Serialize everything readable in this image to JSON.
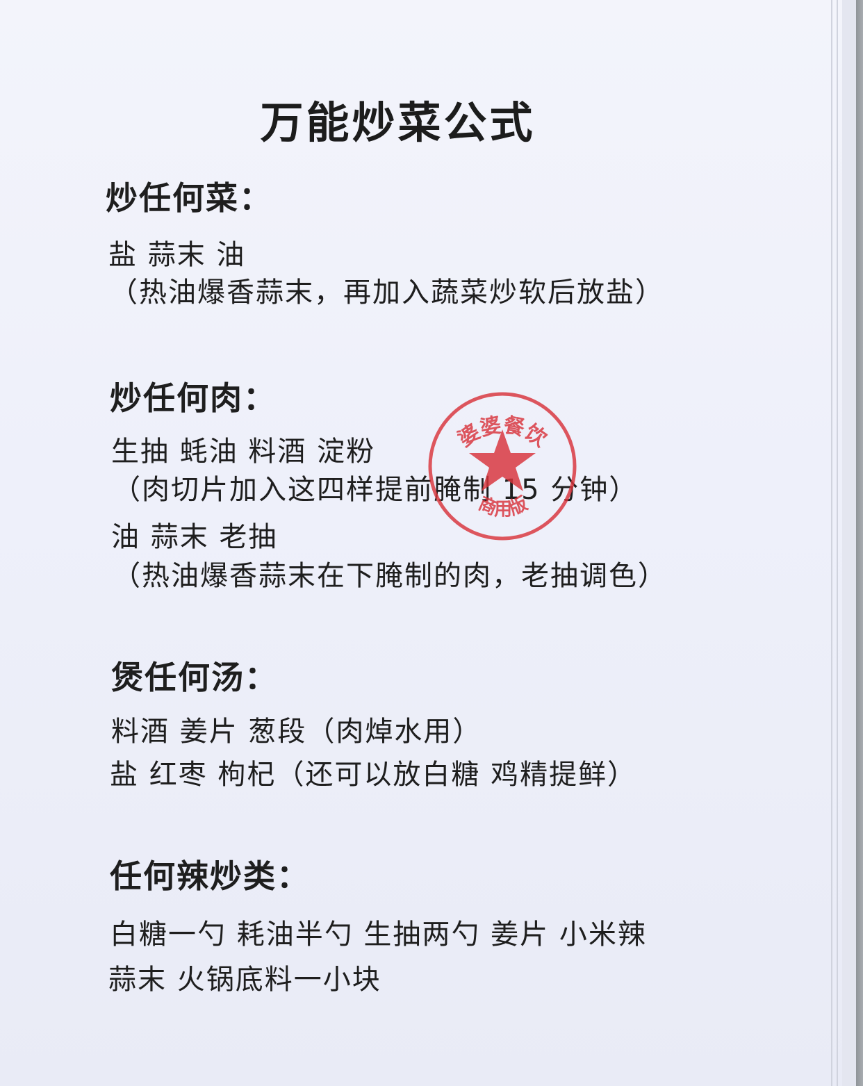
{
  "title": "万能炒菜公式",
  "sections": [
    {
      "heading": "炒任何菜：",
      "lines": [
        "盐 蒜末 油",
        "（热油爆香蒜末，再加入蔬菜炒软后放盐）"
      ]
    },
    {
      "heading": "炒任何肉：",
      "lines": [
        "生抽 蚝油 料酒 淀粉",
        "（肉切片加入这四样提前腌制 15 分钟）",
        "油 蒜末 老抽",
        "（热油爆香蒜末在下腌制的肉，老抽调色）"
      ]
    },
    {
      "heading": "煲任何汤：",
      "lines": [
        "料酒 姜片 葱段（肉焯水用）",
        "盐 红枣 枸杞（还可以放白糖 鸡精提鲜）"
      ]
    },
    {
      "heading": "任何辣炒类：",
      "lines": [
        "白糖一勺 耗油半勺 生抽两勺 姜片 小米辣",
        "蒜末 火锅底料一小块"
      ]
    }
  ],
  "stamp": {
    "color": "#d9333b",
    "text_top": "婆婆餐饮",
    "text_bottom": "商用版"
  }
}
